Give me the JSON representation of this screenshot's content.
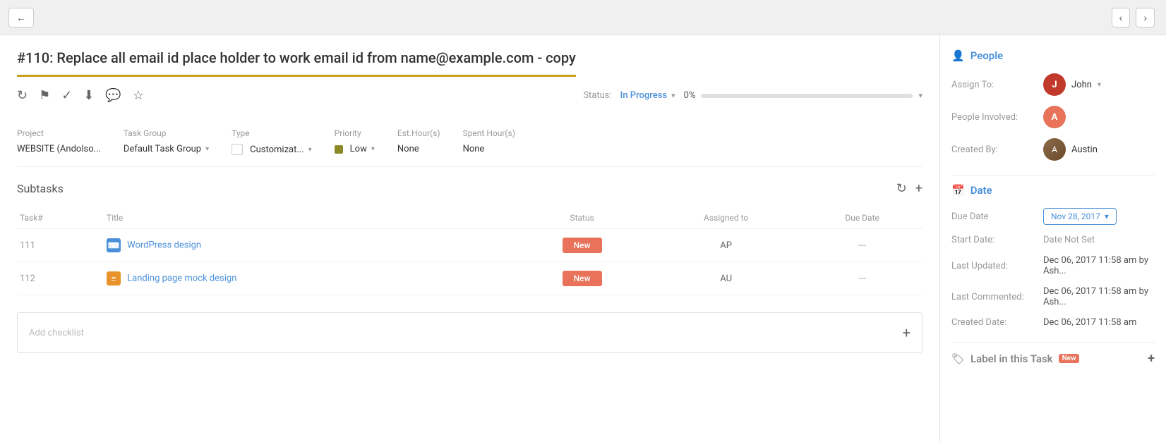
{
  "topBar": {
    "backLabel": "←",
    "prevLabel": "‹",
    "nextLabel": "›"
  },
  "task": {
    "id": "#110",
    "title": "#110: Replace all email id place holder to work email id from name@example.com - copy",
    "status": {
      "label": "Status:",
      "value": "In Progress",
      "arrow": "▾"
    },
    "progress": {
      "value": "0%",
      "arrow": "▾"
    },
    "toolbar": {
      "icons": [
        "↻",
        "⚑",
        "✓",
        "⬇",
        "💬",
        "☆"
      ]
    },
    "project": {
      "label": "Project",
      "value": "WEBSITE (Andolso..."
    },
    "taskGroup": {
      "label": "Task Group",
      "value": "Default Task Group",
      "arrow": "▾"
    },
    "type": {
      "label": "Type",
      "value": "Customizat...",
      "arrow": "▾"
    },
    "priority": {
      "label": "Priority",
      "value": "Low",
      "arrow": "▾"
    },
    "estHours": {
      "label": "Est.Hour(s)",
      "value": "None"
    },
    "spentHours": {
      "label": "Spent Hour(s)",
      "value": "None"
    }
  },
  "subtasks": {
    "title": "Subtasks",
    "columns": {
      "taskNum": "Task#",
      "title": "Title",
      "status": "Status",
      "assignedTo": "Assigned to",
      "dueDate": "Due Date"
    },
    "rows": [
      {
        "num": "111",
        "iconType": "code",
        "iconLabel": "⌨",
        "title": "WordPress design",
        "status": "New",
        "assignedTo": "AP",
        "dueDate": "---"
      },
      {
        "num": "112",
        "iconType": "task",
        "iconLabel": "≡",
        "title": "Landing page mock design",
        "status": "New",
        "assignedTo": "AU",
        "dueDate": "---"
      }
    ]
  },
  "checklist": {
    "placeholder": "Add checklist"
  },
  "sidebar": {
    "people": {
      "sectionTitle": "People",
      "assignTo": {
        "label": "Assign To:",
        "name": "John",
        "avatarInitial": "J"
      },
      "peopleInvolved": {
        "label": "People Involved:",
        "avatarInitial": "A"
      },
      "createdBy": {
        "label": "Created By:",
        "name": "Austin"
      }
    },
    "date": {
      "sectionTitle": "Date",
      "dueDate": {
        "label": "Due Date",
        "value": "Nov 28, 2017",
        "arrow": "▾"
      },
      "startDate": {
        "label": "Start Date:",
        "value": "Date Not Set"
      },
      "lastUpdated": {
        "label": "Last Updated:",
        "value": "Dec 06, 2017 11:58 am by Ash..."
      },
      "lastCommented": {
        "label": "Last Commented:",
        "value": "Dec 06, 2017 11:58 am by Ash..."
      },
      "createdDate": {
        "label": "Created Date:",
        "value": "Dec 06, 2017 11:58 am"
      }
    },
    "label": {
      "sectionTitle": "Label in this Task",
      "badge": "New"
    }
  }
}
